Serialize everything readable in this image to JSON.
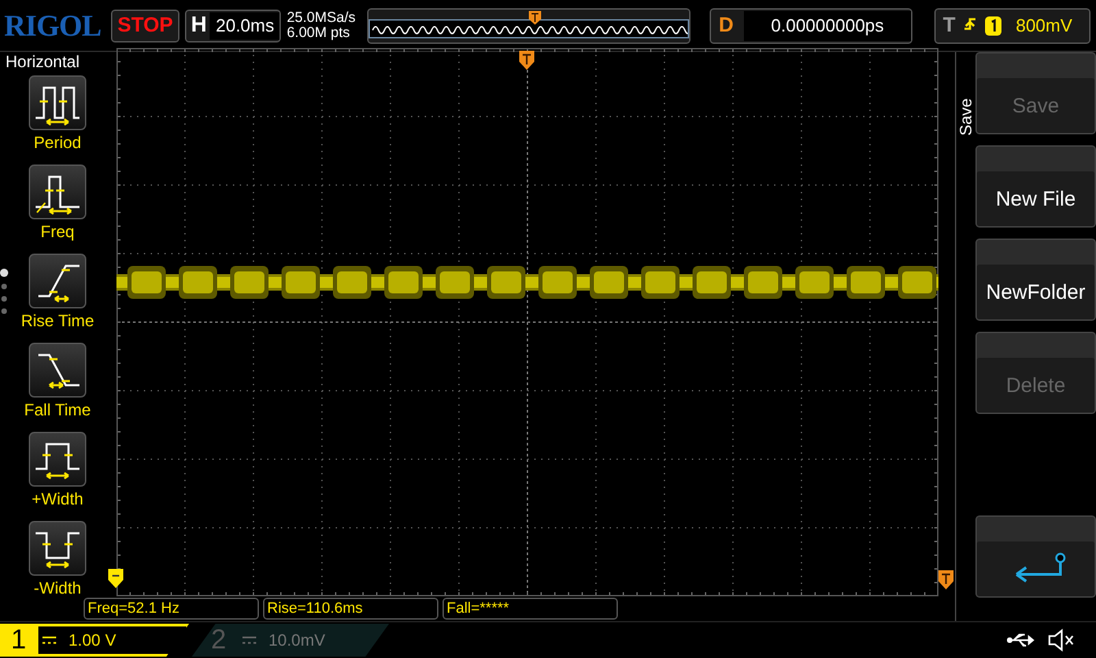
{
  "brand": "RIGOL",
  "run_state": "STOP",
  "horizontal": {
    "label": "H",
    "timebase": "20.0ms",
    "sample_rate": "25.0MSa/s",
    "memory_depth": "6.00M pts"
  },
  "delay": {
    "label": "D",
    "value": "0.00000000ps"
  },
  "trigger": {
    "label": "T",
    "level": "800mV"
  },
  "left_menu": {
    "title": "Horizontal",
    "items": [
      {
        "label": "Period",
        "kind": "period"
      },
      {
        "label": "Freq",
        "kind": "freq"
      },
      {
        "label": "Rise Time",
        "kind": "rise"
      },
      {
        "label": "Fall Time",
        "kind": "fall"
      },
      {
        "label": "+Width",
        "kind": "pwidth"
      },
      {
        "label": "-Width",
        "kind": "nwidth"
      }
    ],
    "pages": [
      {
        "selected": true
      },
      {
        "selected": false
      },
      {
        "selected": false
      },
      {
        "selected": false
      }
    ]
  },
  "right_menu": {
    "title": "Save",
    "buttons": [
      {
        "kind": "text",
        "label": "Save",
        "disabled": true
      },
      {
        "kind": "text",
        "label": "New File",
        "disabled": false
      },
      {
        "kind": "text",
        "label": "NewFolder",
        "disabled": false
      },
      {
        "kind": "text",
        "label": "Delete",
        "disabled": true
      },
      {
        "kind": "back",
        "disabled": false
      }
    ]
  },
  "measurements": [
    "Freq=52.1 Hz",
    "Rise=110.6ms",
    "Fall=*****"
  ],
  "channels": [
    {
      "number": "1",
      "scale": "1.00 V",
      "on": true
    },
    {
      "number": "2",
      "scale": "10.0mV",
      "on": false
    }
  ]
}
